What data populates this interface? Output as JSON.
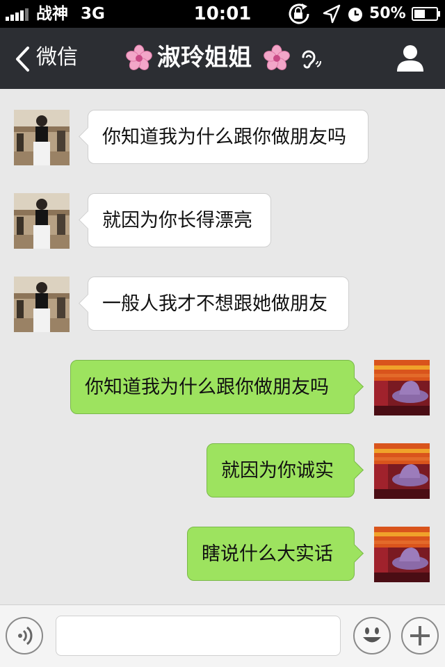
{
  "status_bar": {
    "carrier": "战神",
    "network": "3G",
    "time": "10:01",
    "battery_percent": "50%",
    "battery_level": 0.5,
    "signal_bars": 4
  },
  "nav": {
    "back_label": "微信",
    "title": "淑玲姐姐",
    "title_flower_icons": [
      "cherry-blossom-icon",
      "cherry-blossom-icon"
    ],
    "ear_icon": "earpiece-mode-icon",
    "profile_icon": "person-icon"
  },
  "messages": [
    {
      "side": "incoming",
      "text": "你知道我为什么跟你做朋友吗"
    },
    {
      "side": "incoming",
      "text": "就因为你长得漂亮"
    },
    {
      "side": "incoming",
      "text": "一般人我才不想跟她做朋友"
    },
    {
      "side": "outgoing",
      "text": "你知道我为什么跟你做朋友吗"
    },
    {
      "side": "outgoing",
      "text": "就因为你诚实"
    },
    {
      "side": "outgoing",
      "text": "瞎说什么大实话"
    }
  ],
  "input_bar": {
    "voice_icon": "voice-icon",
    "text_value": "",
    "emoji_icon": "emoji-icon",
    "plus_icon": "plus-icon"
  },
  "colors": {
    "nav_background": "#2c2e33",
    "chat_background": "#e8e8e8",
    "incoming_bubble": "#ffffff",
    "outgoing_bubble": "#9de35f"
  }
}
